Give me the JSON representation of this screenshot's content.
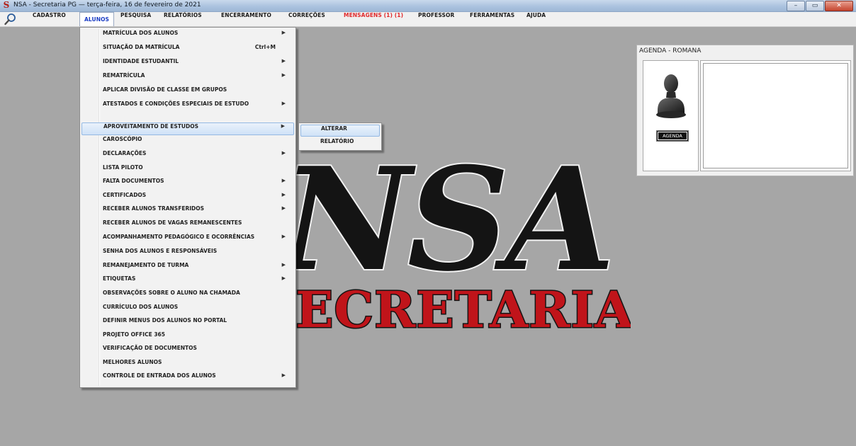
{
  "window": {
    "title": "NSA - Secretaria PG — terça-feira, 16 de fevereiro de 2021",
    "logo_letter": "S",
    "minimize": "–",
    "maximize": "▭",
    "close": "✕"
  },
  "menubar": {
    "items": [
      {
        "label": "CADASTRO"
      },
      {
        "label": "ALUNOS"
      },
      {
        "label": "PESQUISA"
      },
      {
        "label": "RELATÓRIOS"
      },
      {
        "label": "ENCERRAMENTO"
      },
      {
        "label": "CORREÇÕES"
      },
      {
        "label": "MENSAGENS (1) (1)"
      },
      {
        "label": "PROFESSOR"
      },
      {
        "label": "FERRAMENTAS"
      },
      {
        "label": "AJUDA"
      }
    ]
  },
  "dropdown": {
    "items": [
      {
        "label": "MATRÍCULA DOS ALUNOS",
        "arrow": "▶"
      },
      {
        "label": "SITUAÇÃO DA MATRÍCULA",
        "shortcut": "Ctrl+M"
      },
      {
        "label": "IDENTIDADE ESTUDANTIL",
        "arrow": "▶"
      },
      {
        "label": "REMATRÍCULA",
        "arrow": "▶"
      },
      {
        "label": "APLICAR DIVISÃO DE CLASSE EM GRUPOS"
      },
      {
        "label": "ATESTADOS E CONDIÇÕES ESPECIAIS DE ESTUDO",
        "arrow": "▶"
      },
      {
        "label": "APROVEITAMENTO DE ESTUDOS",
        "arrow": "▶"
      },
      {
        "label": "CAROSCÓPIO"
      },
      {
        "label": "DECLARAÇÕES",
        "arrow": "▶"
      },
      {
        "label": "LISTA PILOTO"
      },
      {
        "label": "FALTA DOCUMENTOS",
        "arrow": "▶"
      },
      {
        "label": "CERTIFICADOS",
        "arrow": "▶"
      },
      {
        "label": "RECEBER ALUNOS TRANSFERIDOS",
        "arrow": "▶"
      },
      {
        "label": "RECEBER ALUNOS DE VAGAS REMANESCENTES"
      },
      {
        "label": "ACOMPANHAMENTO PEDAGÓGICO E OCORRÊNCIAS",
        "arrow": "▶"
      },
      {
        "label": "SENHA DOS ALUNOS E RESPONSÁVEIS"
      },
      {
        "label": "REMANEJAMENTO DE TURMA",
        "arrow": "▶"
      },
      {
        "label": "ETIQUETAS",
        "arrow": "▶"
      },
      {
        "label": "OBSERVAÇÕES SOBRE O ALUNO NA CHAMADA"
      },
      {
        "label": "CURRÍCULO DOS ALUNOS"
      },
      {
        "label": "DEFINIR MENUS DOS ALUNOS NO PORTAL"
      },
      {
        "label": "PROJETO OFFICE 365"
      },
      {
        "label": "VERIFICAÇÃO DE DOCUMENTOS"
      },
      {
        "label": "MELHORES ALUNOS"
      },
      {
        "label": "CONTROLE DE ENTRADA DOS ALUNOS",
        "arrow": "▶"
      }
    ]
  },
  "submenu": {
    "items": [
      {
        "label": "ALTERAR"
      },
      {
        "label": "RELATÓRIO"
      }
    ]
  },
  "logo": {
    "main": "NSA",
    "sub": "SECRETARIA"
  },
  "agenda": {
    "title": "AGENDA - ROMANA",
    "button": "AGENDA"
  },
  "colors": {
    "desktop": "#a6a6a6",
    "active_menu": "#1a3cc4",
    "alert_menu": "#e0282a",
    "logo_red": "#c0141a"
  }
}
